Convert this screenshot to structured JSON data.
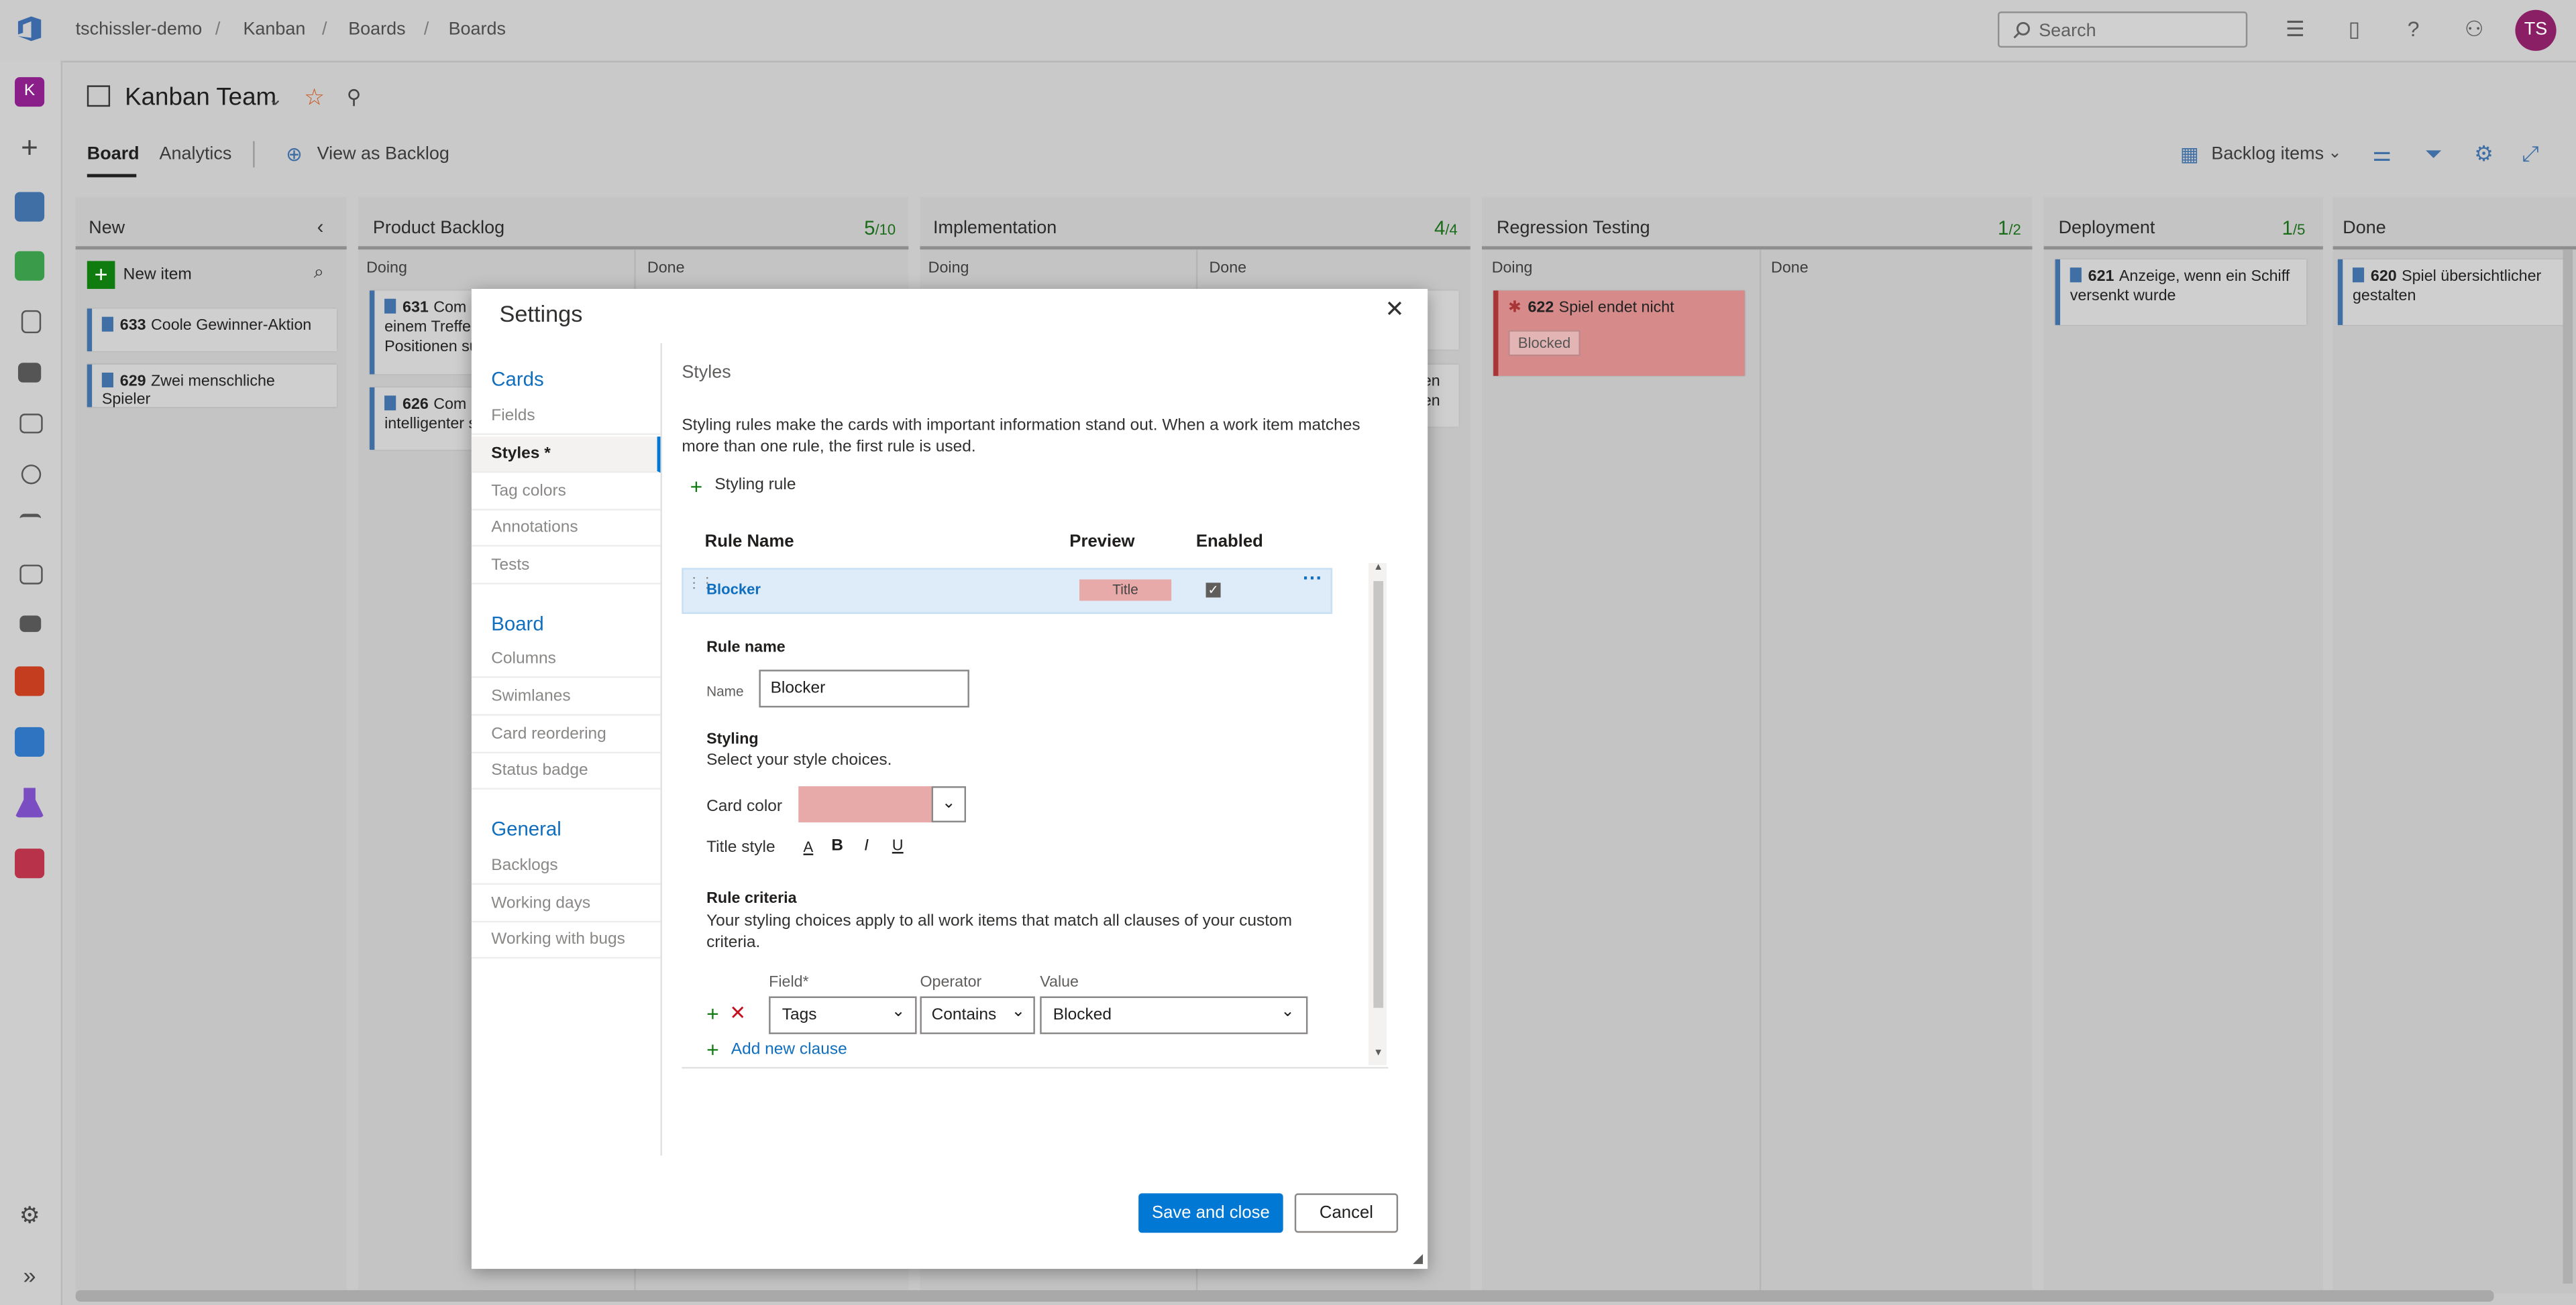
{
  "breadcrumb": [
    "tschissler-demo",
    "Kanban",
    "Boards",
    "Boards"
  ],
  "search": {
    "placeholder": "Search"
  },
  "user": {
    "initials": "TS"
  },
  "nav": {
    "project_initial": "K"
  },
  "team": {
    "title": "Kanban Team"
  },
  "tabs": {
    "board": "Board",
    "analytics": "Analytics",
    "view_backlog": "View as Backlog"
  },
  "toolbar": {
    "backlog_items": "Backlog items"
  },
  "columns": [
    {
      "name": "New"
    },
    {
      "name": "Product Backlog",
      "count": "5",
      "limit": "/10"
    },
    {
      "name": "Implementation",
      "count": "4",
      "limit": "/4"
    },
    {
      "name": "Regression Testing",
      "count": "1",
      "limit": "/2"
    },
    {
      "name": "Deployment",
      "count": "1",
      "limit": "/5"
    },
    {
      "name": "Done"
    }
  ],
  "sub": {
    "doing": "Doing",
    "done": "Done"
  },
  "new_item": "New item",
  "cards": {
    "c633": {
      "id": "633",
      "title": "Coole Gewinner-Aktion"
    },
    "c629": {
      "id": "629",
      "title": "Zwei menschliche Spieler"
    },
    "c631": {
      "id": "631",
      "title": "Com",
      "line2": "einem Treffer",
      "line3": "Positionen su"
    },
    "c626": {
      "id": "626",
      "title": "Com",
      "line2": "intelligenter s"
    },
    "c_impl2_a": "en",
    "c_impl2_b": "en",
    "c622": {
      "id": "622",
      "title": "Spiel endet nicht",
      "tag": "Blocked"
    },
    "c621": {
      "id": "621",
      "title": "Anzeige, wenn ein Schiff",
      "line2": "versenkt wurde"
    },
    "c620": {
      "id": "620",
      "title": "Spiel übersichtlicher",
      "line2": "gestalten"
    }
  },
  "dialog": {
    "title": "Settings",
    "sidebar": {
      "cards_title": "Cards",
      "cards_items": [
        "Fields",
        "Styles *",
        "Tag colors",
        "Annotations",
        "Tests"
      ],
      "board_title": "Board",
      "board_items": [
        "Columns",
        "Swimlanes",
        "Card reordering",
        "Status badge"
      ],
      "general_title": "General",
      "general_items": [
        "Backlogs",
        "Working days",
        "Working with bugs"
      ]
    },
    "heading": "Styles",
    "description": "Styling rules make the cards with important information stand out. When a work item matches more than one rule, the first rule is used.",
    "add_rule": "Styling rule",
    "table": {
      "col_name": "Rule Name",
      "col_preview": "Preview",
      "col_enabled": "Enabled"
    },
    "rule": {
      "name": "Blocker",
      "preview": "Title",
      "enabled": true
    },
    "rule_name_label": "Rule name",
    "name_label": "Name",
    "name_value": "Blocker",
    "styling_label": "Styling",
    "styling_desc": "Select your style choices.",
    "card_color_label": "Card color",
    "card_color": "#e8a9a9",
    "title_style_label": "Title style",
    "style_buttons": [
      "A",
      "B",
      "I",
      "U"
    ],
    "criteria_label": "Rule criteria",
    "criteria_desc": "Your styling choices apply to all work items that match all clauses of your custom criteria.",
    "clause_headers": {
      "field": "Field*",
      "operator": "Operator",
      "value": "Value"
    },
    "clause": {
      "field": "Tags",
      "operator": "Contains",
      "value": "Blocked"
    },
    "add_clause": "Add new clause",
    "save": "Save and close",
    "cancel": "Cancel"
  }
}
